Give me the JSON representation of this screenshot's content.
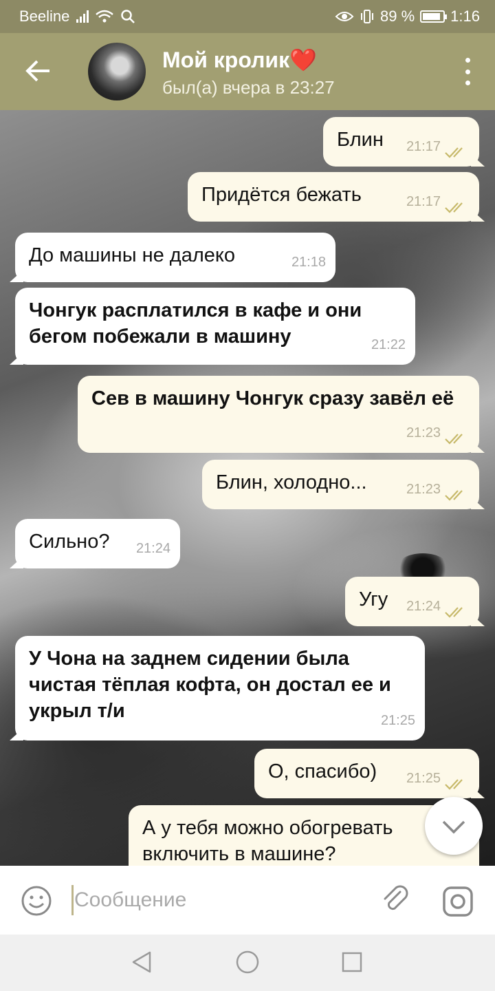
{
  "status": {
    "carrier": "Beeline",
    "battery": "89 %",
    "battery_level": 0.89,
    "time": "1:16"
  },
  "header": {
    "title": "Мой кролик❤️",
    "subtitle": "был(а) вчера в 23:27"
  },
  "messages": [
    {
      "dir": "out",
      "text": "Блин",
      "time": "21:17"
    },
    {
      "dir": "out",
      "text": "Придётся бежать",
      "time": "21:17"
    },
    {
      "dir": "in",
      "text": "До машины не далеко",
      "time": "21:18"
    },
    {
      "dir": "in",
      "text": "Чонгук расплатился в кафе и они бегом побежали в машину",
      "time": "21:22"
    },
    {
      "dir": "out",
      "text": "Сев в машину Чонгук сразу завёл её",
      "time": "21:23"
    },
    {
      "dir": "out",
      "text": "Блин, холодно...",
      "time": "21:23"
    },
    {
      "dir": "in",
      "text": "Сильно?",
      "time": "21:24"
    },
    {
      "dir": "out",
      "text": "Угу",
      "time": "21:24"
    },
    {
      "dir": "in",
      "text": "У Чона на заднем сидении была чистая тёплая кофта, он достал ее и укрыл т/и",
      "time": "21:25"
    },
    {
      "dir": "out",
      "text": "О, спасибо)",
      "time": "21:25"
    },
    {
      "dir": "out",
      "text": "А у тебя можно обогревать включить в машине?",
      "time": ""
    }
  ],
  "composer": {
    "placeholder": "Сообщение"
  },
  "colors": {
    "header": "#a29f72",
    "status_bar": "#8d8a65",
    "outgoing_bubble": "#fdf9e9",
    "incoming_bubble": "#ffffff",
    "read_checks": "#c7b96a"
  },
  "icons": [
    "back-arrow-icon",
    "more-vert-icon",
    "double-check-icon",
    "chevron-down-icon",
    "emoji-icon",
    "attach-icon",
    "camera-icon",
    "nav-back-icon",
    "nav-home-icon",
    "nav-recents-icon"
  ]
}
